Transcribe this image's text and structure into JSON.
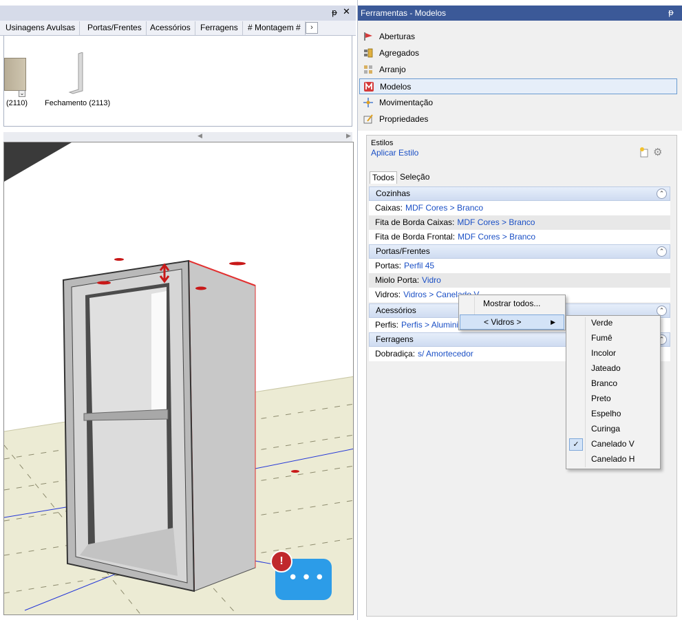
{
  "left_panel": {
    "pin_glyph": "ᵽ",
    "close_glyph": "✕",
    "tabs": [
      "Usinagens Avulsas",
      "Portas/Frentes",
      "Acessórios",
      "Ferragens",
      "# Montagem #"
    ],
    "tabs_more": "›",
    "catalog_items": [
      {
        "label": "(2110)",
        "icon": "cabinet-icon"
      },
      {
        "label": "Fechamento (2113)",
        "icon": "panel-icon"
      }
    ]
  },
  "chat": {
    "alert": "!",
    "dots": "•••"
  },
  "right_panel": {
    "title": "Ferramentas - Modelos",
    "pin_glyph": "ᵽ",
    "tools": [
      {
        "label": "Aberturas",
        "icon": "flag-icon"
      },
      {
        "label": "Agregados",
        "icon": "aggregates-icon"
      },
      {
        "label": "Arranjo",
        "icon": "grid-icon"
      },
      {
        "label": "Modelos",
        "icon": "models-icon",
        "selected": true
      },
      {
        "label": "Movimentação",
        "icon": "move-icon"
      },
      {
        "label": "Propriedades",
        "icon": "properties-icon"
      }
    ],
    "styles": {
      "header": "Estilos",
      "apply_link": "Aplicar Estilo",
      "tabs": [
        "Todos",
        "Seleção"
      ],
      "sections": [
        {
          "title": "Cozinhas",
          "rows": [
            {
              "label": "Caixas:",
              "value": "MDF Cores > Branco"
            },
            {
              "label": "Fita de Borda Caixas:",
              "value": "MDF Cores > Branco"
            },
            {
              "label": "Fita de Borda Frontal:",
              "value": "MDF Cores > Branco"
            }
          ]
        },
        {
          "title": "Portas/Frentes",
          "rows": [
            {
              "label": "Portas:",
              "value": "Perfil 45"
            },
            {
              "label": "Miolo Porta:",
              "value": "Vidro"
            },
            {
              "label": "Vidros:",
              "value": "Vidros > Canelado V"
            }
          ]
        },
        {
          "title": "Acessórios",
          "rows": [
            {
              "label": "Perfis:",
              "value": "Perfis > Aluminio"
            }
          ]
        },
        {
          "title": "Ferragens",
          "rows": [
            {
              "label": "Dobradiça:",
              "value": "s/ Amortecedor"
            }
          ]
        }
      ]
    }
  },
  "context_menu": {
    "items": [
      "Mostrar todos...",
      "< Vidros >"
    ],
    "submenu_arrow": "▶"
  },
  "submenu": {
    "items": [
      "Verde",
      "Fumê",
      "Incolor",
      "Jateado",
      "Branco",
      "Preto",
      "Espelho",
      "Curinga",
      "Canelado V",
      "Canelado H"
    ],
    "checked": "Canelado V",
    "check_glyph": "✓"
  }
}
